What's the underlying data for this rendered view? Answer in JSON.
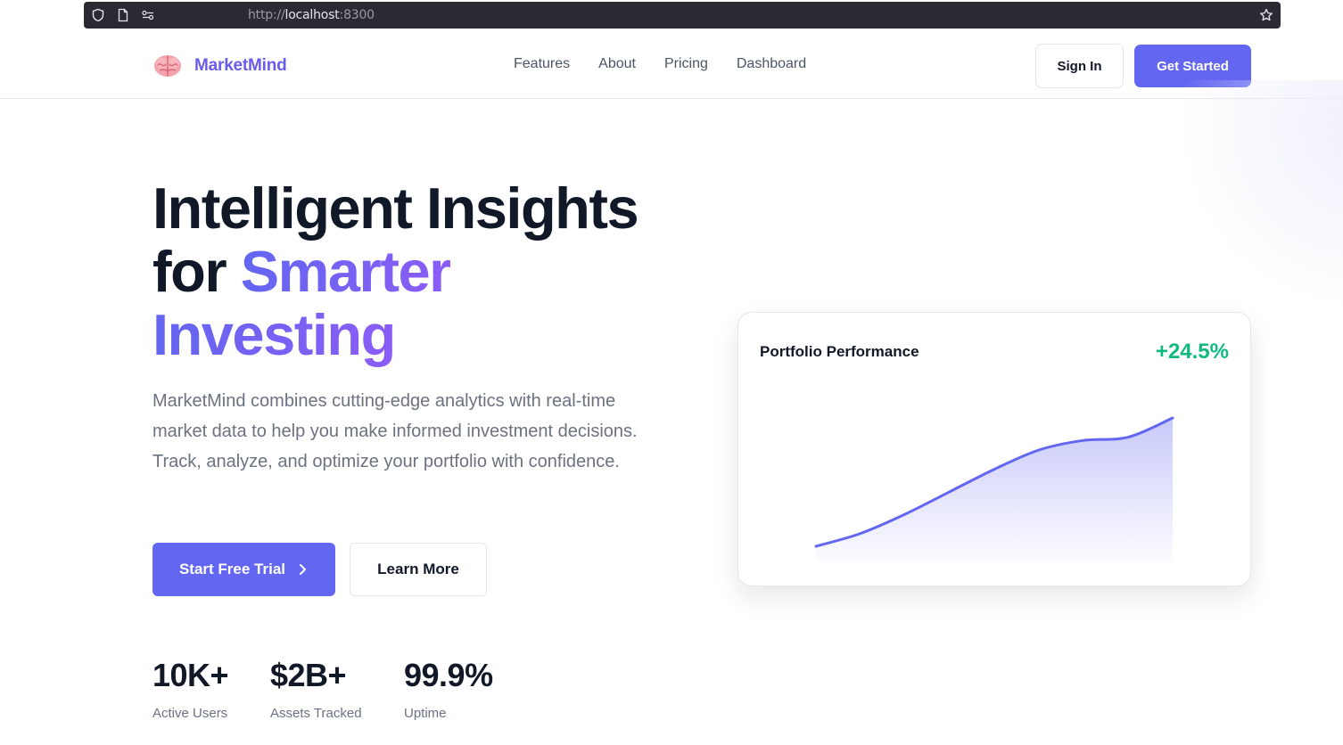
{
  "browser": {
    "url_scheme": "http://",
    "url_host": "localhost",
    "url_port": ":8300"
  },
  "nav": {
    "brand": "MarketMind",
    "links": [
      "Features",
      "About",
      "Pricing",
      "Dashboard"
    ],
    "sign_in": "Sign In",
    "get_started": "Get Started"
  },
  "hero": {
    "title_line1": "Intelligent Insights",
    "title_for": "for ",
    "title_accent1": "Smarter",
    "title_accent2": "Investing",
    "description": "MarketMind combines cutting-edge analytics with real-time market data to help you make informed investment decisions. Track, analyze, and optimize your portfolio with confidence.",
    "primary_cta": "Start Free Trial",
    "secondary_cta": "Learn More"
  },
  "stats": [
    {
      "value": "10K+",
      "label": "Active Users"
    },
    {
      "value": "$2B+",
      "label": "Assets Tracked"
    },
    {
      "value": "99.9%",
      "label": "Uptime"
    }
  ],
  "card": {
    "title": "Portfolio Performance",
    "change": "+24.5%"
  },
  "colors": {
    "brand": "#6366f1",
    "accent_end": "#8b5cf6",
    "positive": "#10b981"
  },
  "chart_data": {
    "type": "area",
    "x": [
      0,
      1,
      2,
      3,
      4,
      5,
      6,
      7,
      8
    ],
    "values": [
      10,
      18,
      30,
      44,
      58,
      70,
      76,
      78,
      90
    ],
    "ylim": [
      0,
      100
    ],
    "grid": false
  }
}
